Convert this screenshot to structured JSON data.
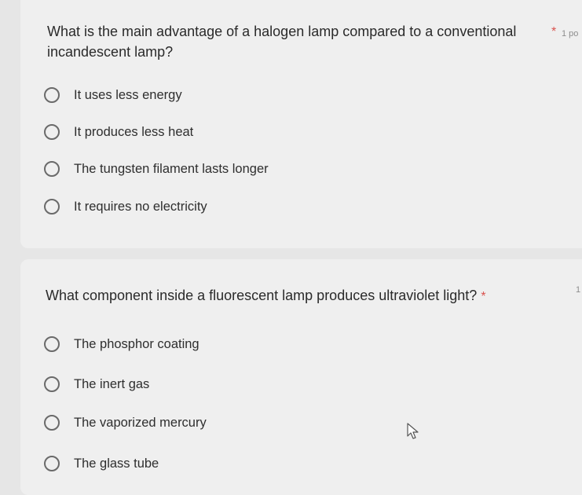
{
  "questions": [
    {
      "text": "What is the main advantage of a halogen lamp compared to a conventional incandescent lamp?",
      "required_marker": "*",
      "points": "1 po",
      "options": [
        "It uses less energy",
        "It produces less heat",
        "The tungsten filament lasts longer",
        "It requires no electricity"
      ]
    },
    {
      "text": "What component inside a fluorescent lamp produces ultraviolet light?",
      "required_marker": "*",
      "points": "1",
      "options": [
        "The phosphor coating",
        "The inert gas",
        "The vaporized mercury",
        "The glass tube"
      ]
    }
  ],
  "colors": {
    "background": "#e6e6e6",
    "card": "#efefef",
    "required": "#d9534f",
    "radio_border": "#6a6a6a"
  },
  "icons": [
    "radio-unselected-icon",
    "mouse-pointer-icon"
  ]
}
